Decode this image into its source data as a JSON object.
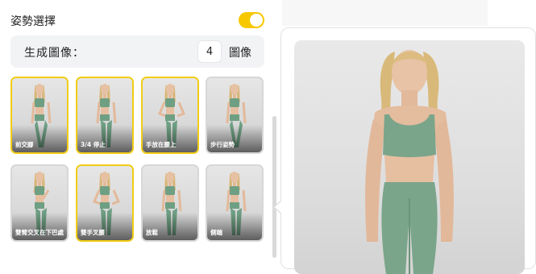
{
  "pose_section": {
    "title": "姿勢選擇",
    "toggle_on": true,
    "accent_color": "#f7c800"
  },
  "generate": {
    "label": "生成圖像：",
    "count": "4",
    "unit": "圖像"
  },
  "poses": [
    {
      "caption": "前交腳",
      "selected": true
    },
    {
      "caption": "3/4 停止",
      "selected": true
    },
    {
      "caption": "手放在腰上",
      "selected": true
    },
    {
      "caption": "步行姿勢",
      "selected": false
    },
    {
      "caption": "雙臂交叉在下巴處",
      "selected": false
    },
    {
      "caption": "雙手叉腰",
      "selected": true
    },
    {
      "caption": "放鬆",
      "selected": false
    },
    {
      "caption": "側端",
      "selected": false
    }
  ],
  "preview": {
    "image": "model-photo",
    "outfit_color": "#7aa58a"
  }
}
